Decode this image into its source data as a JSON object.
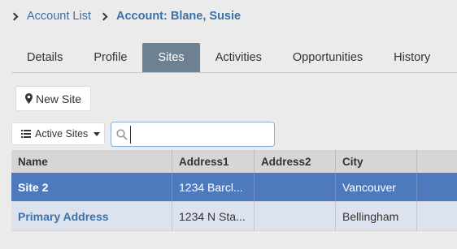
{
  "breadcrumb": {
    "parent": "Account List",
    "current": "Account: Blane, Susie"
  },
  "tabs": [
    {
      "label": "Details",
      "active": false
    },
    {
      "label": "Profile",
      "active": false
    },
    {
      "label": "Sites",
      "active": true
    },
    {
      "label": "Activities",
      "active": false
    },
    {
      "label": "Opportunities",
      "active": false
    },
    {
      "label": "History",
      "active": false
    }
  ],
  "toolbar": {
    "new_site_label": "New Site",
    "filter_label": "Active Sites",
    "search_value": ""
  },
  "grid": {
    "columns": [
      "Name",
      "Address1",
      "Address2",
      "City"
    ],
    "rows": [
      {
        "name": "Site 2",
        "address1": "1234 Barcl...",
        "address2": "",
        "city": "Vancouver",
        "selected": true
      },
      {
        "name": "Primary Address",
        "address1": "1234 N Sta...",
        "address2": "",
        "city": "Bellingham",
        "selected": false
      }
    ]
  },
  "colors": {
    "link": "#3a72a8",
    "active_tab": "#6e8193",
    "selected_row": "#4d79bd",
    "alt_row": "#dde3ee"
  }
}
